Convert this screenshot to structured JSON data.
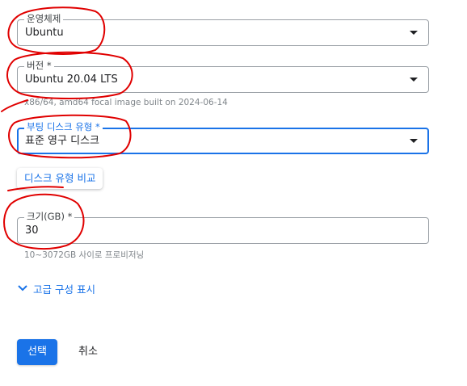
{
  "os_field": {
    "label": "운영체제",
    "value": "Ubuntu"
  },
  "version_field": {
    "label": "버전 *",
    "value": "Ubuntu 20.04 LTS",
    "hint": "x86/64, amd64 focal image built on 2024-06-14"
  },
  "disk_type_field": {
    "label": "부팅 디스크 유형 *",
    "value": "표준 영구 디스크"
  },
  "compare_button": {
    "label": "디스크 유형 비교"
  },
  "size_field": {
    "label": "크기(GB) *",
    "value": "30",
    "hint": "10~3072GB 사이로 프로비저닝"
  },
  "advanced": {
    "label": "고급 구성 표시",
    "icon": "chevron-down-icon"
  },
  "actions": {
    "select_label": "선택",
    "cancel_label": "취소"
  },
  "colors": {
    "accent": "#1a73e8",
    "annotation": "#e00000"
  }
}
